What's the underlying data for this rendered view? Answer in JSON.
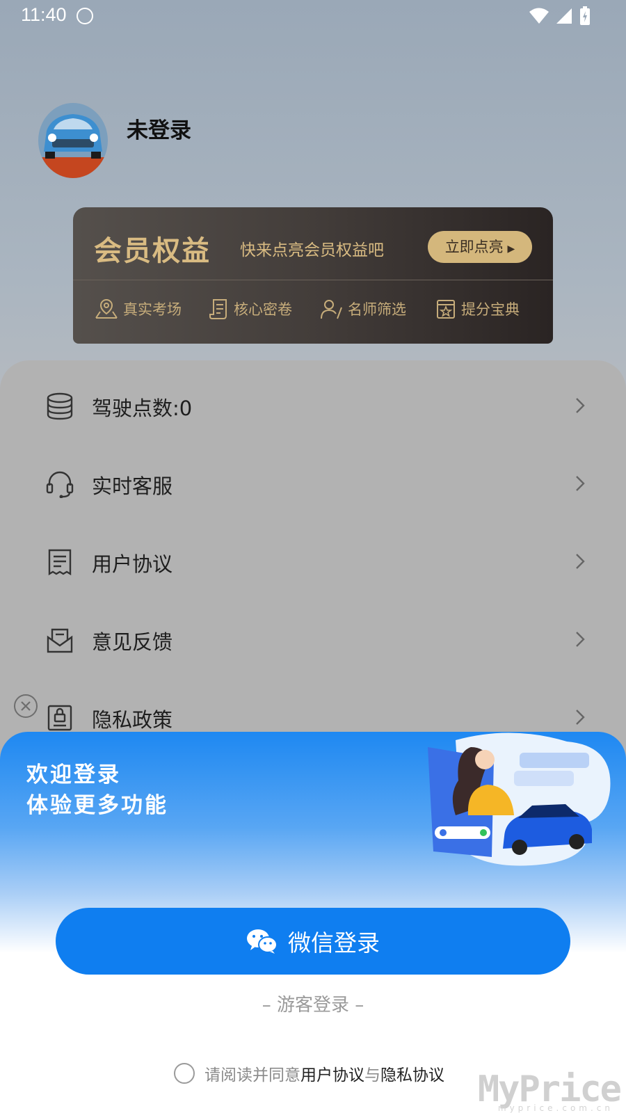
{
  "status_bar": {
    "time": "11:40"
  },
  "profile": {
    "username": "未登录"
  },
  "member_card": {
    "title": "会员权益",
    "subtitle": "快来点亮会员权益吧",
    "button_label": "立即点亮",
    "features": [
      {
        "label": "真实考场",
        "icon": "location-icon"
      },
      {
        "label": "核心密卷",
        "icon": "document-icon"
      },
      {
        "label": "名师筛选",
        "icon": "teacher-icon"
      },
      {
        "label": "提分宝典",
        "icon": "book-star-icon"
      }
    ]
  },
  "menu": {
    "items": [
      {
        "label": "驾驶点数:0",
        "icon": "database-icon"
      },
      {
        "label": "实时客服",
        "icon": "headset-icon"
      },
      {
        "label": "用户协议",
        "icon": "receipt-icon"
      },
      {
        "label": "意见反馈",
        "icon": "mail-icon"
      },
      {
        "label": "隐私政策",
        "icon": "lock-document-icon"
      }
    ]
  },
  "login_sheet": {
    "welcome_line1": "欢迎登录",
    "welcome_line2": "体验更多功能",
    "wechat_button": "微信登录",
    "guest_login": "– 游客登录 –",
    "agree_prefix": "请阅读并同意",
    "agree_user_agreement": "用户协议",
    "agree_and": "与",
    "agree_privacy": "隐私协议",
    "brand_color": "#0f7ef0"
  },
  "watermark": {
    "text": "MyPrice",
    "sub": "myprice.com.cn"
  }
}
